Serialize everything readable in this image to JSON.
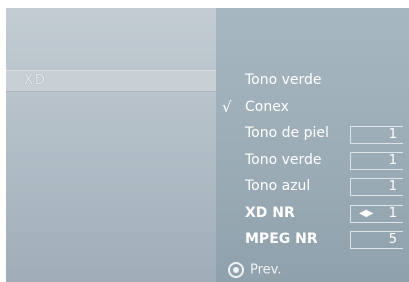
{
  "sidebar": {
    "selected_item": "XD"
  },
  "menu": {
    "items": [
      {
        "label": "Tono verde",
        "value": ""
      },
      {
        "label": "Conex",
        "value": "",
        "checked": "√"
      },
      {
        "label": "Tono de piel",
        "value": "1"
      },
      {
        "label": "Tono verde",
        "value": "1"
      },
      {
        "label": "Tono azul",
        "value": "1"
      },
      {
        "label": "XD NR",
        "value": "1",
        "arrows": "◀▶"
      },
      {
        "label": "MPEG NR",
        "value": "5"
      }
    ]
  },
  "footer": {
    "prev_label": "Prev."
  },
  "colors": {
    "text": "#ffffff",
    "background": "#9aaab4"
  }
}
